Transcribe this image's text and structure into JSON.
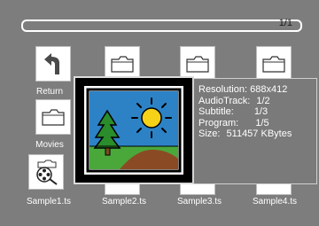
{
  "pager": {
    "text": "1/1"
  },
  "items": [
    {
      "label": "Return",
      "icon": "return-arrow-icon"
    },
    {
      "label": "Movies",
      "icon": "folder-icon"
    },
    {
      "label": "Sample1.ts",
      "icon": "film-reel-icon"
    },
    {
      "label": "Sample2.ts",
      "icon": "folder-icon"
    },
    {
      "label": "Sample3.ts",
      "icon": "folder-icon"
    },
    {
      "label": "Sample4.ts",
      "icon": "folder-icon"
    }
  ],
  "info": {
    "resolution": {
      "key": "Resolution:",
      "value": "688x412"
    },
    "audiotrack": {
      "key": "AudioTrack:",
      "value": "1/2"
    },
    "subtitle": {
      "key": "Subtitle:",
      "value": "1/3"
    },
    "program": {
      "key": "Program:",
      "value": "1/5"
    },
    "size": {
      "key": "Size:",
      "value": "511457 KBytes"
    }
  }
}
